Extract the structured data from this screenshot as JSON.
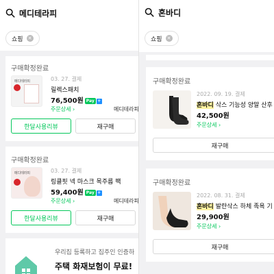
{
  "left": {
    "search_query": "메디테라피",
    "chip_label": "쇼핑",
    "orders": [
      {
        "status": "구매확정완료",
        "date": "03. 27. 결제",
        "name": "릴렉스패치",
        "price": "76,500원",
        "pay_badge": "Pay",
        "detail_link": "주문상세",
        "seller": "메디테라피",
        "review_button": "한달사용리뷰",
        "rebuy_button": "재구매",
        "thumb_text": "메디테라피"
      },
      {
        "status": "구매확정완료",
        "date": "03. 27. 결제",
        "name": "링클핏 넥 마스크 목주름 팩",
        "price": "59,400원",
        "pay_badge": "Pay",
        "detail_link": "주문상세",
        "seller": "메디테라피",
        "review_button": "한달사용리뷰",
        "rebuy_button": "재구매",
        "thumb_text": "메디테라피"
      }
    ],
    "ad": {
      "line1": "우리집 등록하고 집주인 인증하",
      "line2": "주택 화재보험이 무료!"
    }
  },
  "right": {
    "search_query": "혼바디",
    "chip_label": "쇼핑",
    "orders": [
      {
        "status": "구매확정완료",
        "date": "2022. 09. 19. 결제",
        "brand": "혼바디",
        "name": " 삭스 기능성 양말 산후",
        "price": "42,500원",
        "detail_link": "주문상세",
        "rebuy_button": "재구매"
      },
      {
        "status": "구매확정완료",
        "date": "2022. 08. 31. 결제",
        "brand": "혼바디",
        "name": " 발란삭스 하체 족욕 기",
        "price": "29,900원",
        "detail_link": "주문상세",
        "rebuy_button": "재구매"
      }
    ]
  }
}
